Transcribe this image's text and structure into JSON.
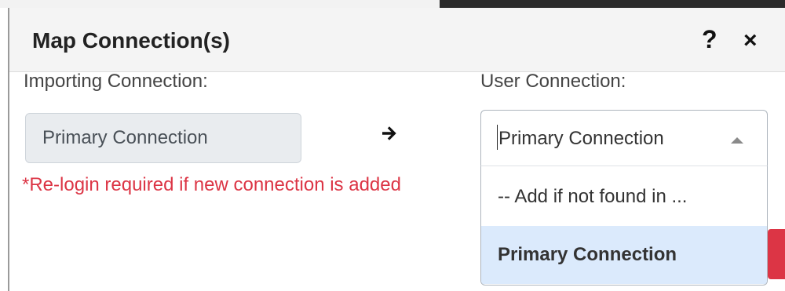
{
  "dialog": {
    "title": "Map Connection(s)",
    "help_glyph": "?",
    "close_glyph": "×"
  },
  "importing": {
    "label": "Importing Connection:",
    "value": "Primary Connection"
  },
  "user": {
    "label": "User Connection:",
    "selected_value": "Primary Connection",
    "options": [
      "-- Add if not found in ...",
      "Primary Connection"
    ]
  },
  "note": "*Re-login required if new connection is added",
  "colors": {
    "note_red": "#dc3545",
    "selected_option_bg": "#dbeafc",
    "readonly_bg": "#e9ecef",
    "header_bg": "#f4f4f4"
  },
  "icons": {
    "help": "question-icon",
    "close": "close-icon",
    "arrow": "arrow-right-icon",
    "dropdown": "chevron-up-icon"
  }
}
